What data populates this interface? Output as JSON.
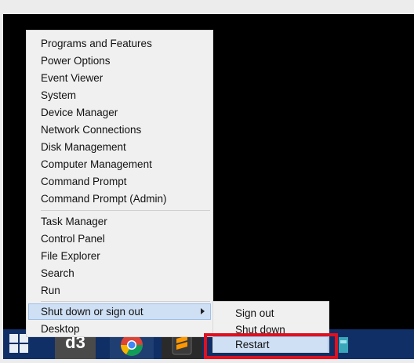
{
  "menu": {
    "items": [
      "Programs and Features",
      "Power Options",
      "Event Viewer",
      "System",
      "Device Manager",
      "Network Connections",
      "Disk Management",
      "Computer Management",
      "Command Prompt",
      "Command Prompt (Admin)",
      "Task Manager",
      "Control Panel",
      "File Explorer",
      "Search",
      "Run",
      "Shut down or sign out",
      "Desktop"
    ]
  },
  "submenu": {
    "items": [
      "Sign out",
      "Shut down",
      "Restart"
    ],
    "selected": "Restart"
  },
  "taskbar": {
    "d3_label": "d3"
  },
  "colors": {
    "highlight": "#cfe0f5",
    "highlight_border": "#9fc0e6",
    "annotation": "#e01020",
    "taskbar": "#0f2f66"
  }
}
